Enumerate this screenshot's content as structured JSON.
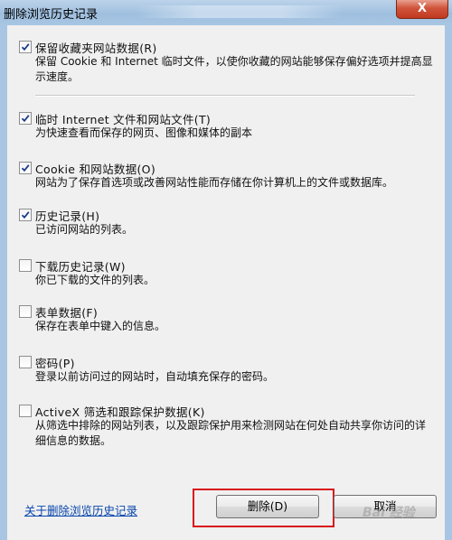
{
  "window": {
    "title": "删除浏览历史记录",
    "close_label": "X"
  },
  "items": [
    {
      "label": "保留收藏夹网站数据(R)",
      "desc": "保留 Cookie 和 Internet 临时文件，以使你收藏的网站能够保存偏好选项并提高显示速度。",
      "checked": true
    },
    {
      "label": "临时 Internet 文件和网站文件(T)",
      "desc": "为快速查看而保存的网页、图像和媒体的副本",
      "checked": true
    },
    {
      "label": "Cookie 和网站数据(O)",
      "desc": "网站为了保存首选项或改善网站性能而存储在你计算机上的文件或数据库。",
      "checked": true
    },
    {
      "label": "历史记录(H)",
      "desc": "已访问网站的列表。",
      "checked": true
    },
    {
      "label": "下载历史记录(W)",
      "desc": "你已下载的文件的列表。",
      "checked": false
    },
    {
      "label": "表单数据(F)",
      "desc": "保存在表单中键入的信息。",
      "checked": false
    },
    {
      "label": "密码(P)",
      "desc": "登录以前访问过的网站时，自动填充保存的密码。",
      "checked": false
    },
    {
      "label": "ActiveX 筛选和跟踪保护数据(K)",
      "desc": "从筛选中排除的网站列表，以及跟踪保护用来检测网站在何处自动共享你访问的详细信息的数据。",
      "checked": false
    }
  ],
  "footer": {
    "about_link": "关于删除浏览历史记录",
    "delete_label": "删除(D)",
    "cancel_label": "取消"
  },
  "watermark": "Bai 经验"
}
